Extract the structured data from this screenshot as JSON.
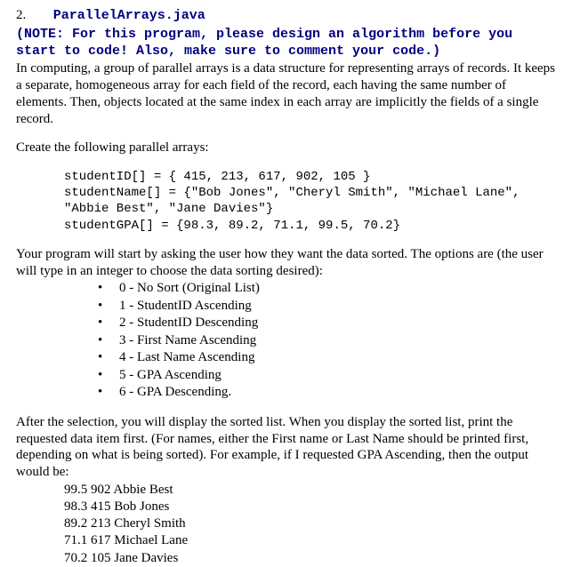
{
  "header": {
    "number": "2.",
    "title": "ParallelArrays.java"
  },
  "note": "(NOTE: For this program, please design an algorithm before you start to code! Also, make sure to comment your code.)",
  "intro": "In computing, a group of parallel arrays is a data structure for representing arrays of records. It keeps a separate, homogeneous array for each field of the record, each having the same number of elements. Then, objects located at the same index in each array are implicitly the fields of a single record.",
  "create_line": "Create the following parallel arrays:",
  "code": "studentID[] = { 415, 213, 617, 902, 105 }\nstudentName[] = {\"Bob Jones\", \"Cheryl Smith\", \"Michael Lane\",\n\"Abbie Best\", \"Jane Davies\"}\nstudentGPA[] = {98.3, 89.2, 71.1, 99.5, 70.2}",
  "prompt_text": "Your program will start by asking the user how they want the data sorted.  The options are (the user will type in an integer to choose the data sorting desired):",
  "options": [
    "0 - No Sort (Original List)",
    "1 - StudentID Ascending",
    "2 - StudentID Descending",
    "3 - First Name Ascending",
    "4 - Last Name Ascending",
    "5 - GPA Ascending",
    "6 - GPA Descending."
  ],
  "after_text": "After the selection, you will display the sorted list. When you display the sorted list, print the requested data item first.  (For names, either the First name or Last Name should be printed first, depending on what is being sorted).  For example, if I requested GPA Ascending, then the output would be:",
  "output": "99.5 902 Abbie Best\n98.3 415 Bob Jones\n89.2 213 Cheryl Smith\n71.1 617 Michael Lane\n70.2 105 Jane Davies"
}
